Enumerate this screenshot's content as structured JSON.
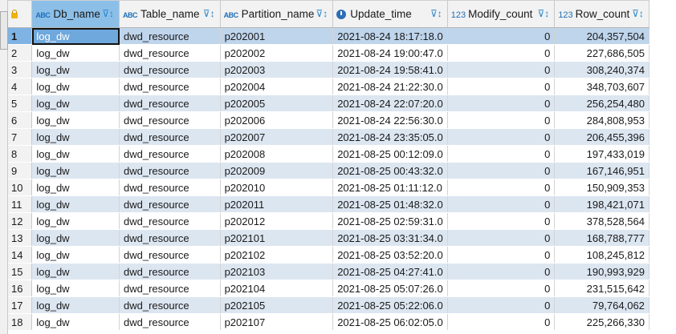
{
  "columns": [
    {
      "label": "Db_name",
      "type_icon": "ABC"
    },
    {
      "label": "Table_name",
      "type_icon": "ABC"
    },
    {
      "label": "Partition_name",
      "type_icon": "ABC"
    },
    {
      "label": "Update_time",
      "type_icon": "clock"
    },
    {
      "label": "Modify_count",
      "type_icon": "123"
    },
    {
      "label": "Row_count",
      "type_icon": "123"
    }
  ],
  "rows": [
    {
      "n": "1",
      "db": "log_dw",
      "table": "dwd_resource",
      "part": "p202001",
      "time": "2021-08-24 18:17:18.0",
      "mod": "0",
      "count": "204,357,504"
    },
    {
      "n": "2",
      "db": "log_dw",
      "table": "dwd_resource",
      "part": "p202002",
      "time": "2021-08-24 19:00:47.0",
      "mod": "0",
      "count": "227,686,505"
    },
    {
      "n": "3",
      "db": "log_dw",
      "table": "dwd_resource",
      "part": "p202003",
      "time": "2021-08-24 19:58:41.0",
      "mod": "0",
      "count": "308,240,374"
    },
    {
      "n": "4",
      "db": "log_dw",
      "table": "dwd_resource",
      "part": "p202004",
      "time": "2021-08-24 21:22:30.0",
      "mod": "0",
      "count": "348,703,607"
    },
    {
      "n": "5",
      "db": "log_dw",
      "table": "dwd_resource",
      "part": "p202005",
      "time": "2021-08-24 22:07:20.0",
      "mod": "0",
      "count": "256,254,480"
    },
    {
      "n": "6",
      "db": "log_dw",
      "table": "dwd_resource",
      "part": "p202006",
      "time": "2021-08-24 22:56:30.0",
      "mod": "0",
      "count": "284,808,953"
    },
    {
      "n": "7",
      "db": "log_dw",
      "table": "dwd_resource",
      "part": "p202007",
      "time": "2021-08-24 23:35:05.0",
      "mod": "0",
      "count": "206,455,396"
    },
    {
      "n": "8",
      "db": "log_dw",
      "table": "dwd_resource",
      "part": "p202008",
      "time": "2021-08-25 00:12:09.0",
      "mod": "0",
      "count": "197,433,019"
    },
    {
      "n": "9",
      "db": "log_dw",
      "table": "dwd_resource",
      "part": "p202009",
      "time": "2021-08-25 00:43:32.0",
      "mod": "0",
      "count": "167,146,951"
    },
    {
      "n": "10",
      "db": "log_dw",
      "table": "dwd_resource",
      "part": "p202010",
      "time": "2021-08-25 01:11:12.0",
      "mod": "0",
      "count": "150,909,353"
    },
    {
      "n": "11",
      "db": "log_dw",
      "table": "dwd_resource",
      "part": "p202011",
      "time": "2021-08-25 01:48:32.0",
      "mod": "0",
      "count": "198,421,071"
    },
    {
      "n": "12",
      "db": "log_dw",
      "table": "dwd_resource",
      "part": "p202012",
      "time": "2021-08-25 02:59:31.0",
      "mod": "0",
      "count": "378,528,564"
    },
    {
      "n": "13",
      "db": "log_dw",
      "table": "dwd_resource",
      "part": "p202101",
      "time": "2021-08-25 03:31:34.0",
      "mod": "0",
      "count": "168,788,777"
    },
    {
      "n": "14",
      "db": "log_dw",
      "table": "dwd_resource",
      "part": "p202102",
      "time": "2021-08-25 03:52:20.0",
      "mod": "0",
      "count": "108,245,812"
    },
    {
      "n": "15",
      "db": "log_dw",
      "table": "dwd_resource",
      "part": "p202103",
      "time": "2021-08-25 04:27:41.0",
      "mod": "0",
      "count": "190,993,929"
    },
    {
      "n": "16",
      "db": "log_dw",
      "table": "dwd_resource",
      "part": "p202104",
      "time": "2021-08-25 05:07:26.0",
      "mod": "0",
      "count": "231,515,642"
    },
    {
      "n": "17",
      "db": "log_dw",
      "table": "dwd_resource",
      "part": "p202105",
      "time": "2021-08-25 05:22:06.0",
      "mod": "0",
      "count": "79,764,062"
    },
    {
      "n": "18",
      "db": "log_dw",
      "table": "dwd_resource",
      "part": "p202107",
      "time": "2021-08-25 06:02:05.0",
      "mod": "0",
      "count": "225,266,330"
    }
  ]
}
